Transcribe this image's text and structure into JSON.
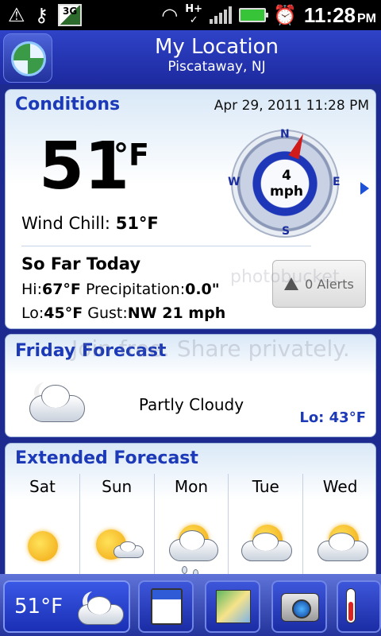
{
  "status_bar": {
    "network": "3G",
    "data": "H+",
    "time": "11:28",
    "ampm": "PM"
  },
  "header": {
    "title": "My Location",
    "subtitle": "Piscataway, NJ"
  },
  "conditions": {
    "title": "Conditions",
    "datetime": "Apr 29, 2011 11:28 PM",
    "temperature": "51",
    "unit": "°F",
    "wind_chill_label": "Wind Chill:",
    "wind_chill_value": "51°F",
    "wind_speed": "4",
    "wind_unit": "mph",
    "compass": {
      "n": "N",
      "s": "S",
      "e": "E",
      "w": "W"
    },
    "so_far_title": "So Far Today",
    "hi_label": "Hi:",
    "hi_value": "67°F",
    "lo_label": "Lo:",
    "lo_value": "45°F",
    "precip_label": "Precipitation:",
    "precip_value": "0.0\"",
    "gust_label": "Gust:",
    "gust_value": "NW 21 mph",
    "alerts_label": "0 Alerts"
  },
  "watermark": {
    "line1": "Join free. Share privately.",
    "line2": "photobucket"
  },
  "friday": {
    "title": "Friday Forecast",
    "condition": "Partly Cloudy",
    "lo": "Lo: 43°F"
  },
  "extended": {
    "title": "Extended Forecast",
    "days": [
      {
        "name": "Sat",
        "icon": "sunny-haze-icon"
      },
      {
        "name": "Sun",
        "icon": "mostly-sunny-icon"
      },
      {
        "name": "Mon",
        "icon": "showers-icon"
      },
      {
        "name": "Tue",
        "icon": "partly-cloudy-icon"
      },
      {
        "name": "Wed",
        "icon": "partly-cloudy-icon"
      }
    ]
  },
  "dock": {
    "temperature": "51°F"
  },
  "colors": {
    "accent": "#1c3ab8",
    "header": "#2f43c8",
    "needle": "#d11a1a"
  }
}
